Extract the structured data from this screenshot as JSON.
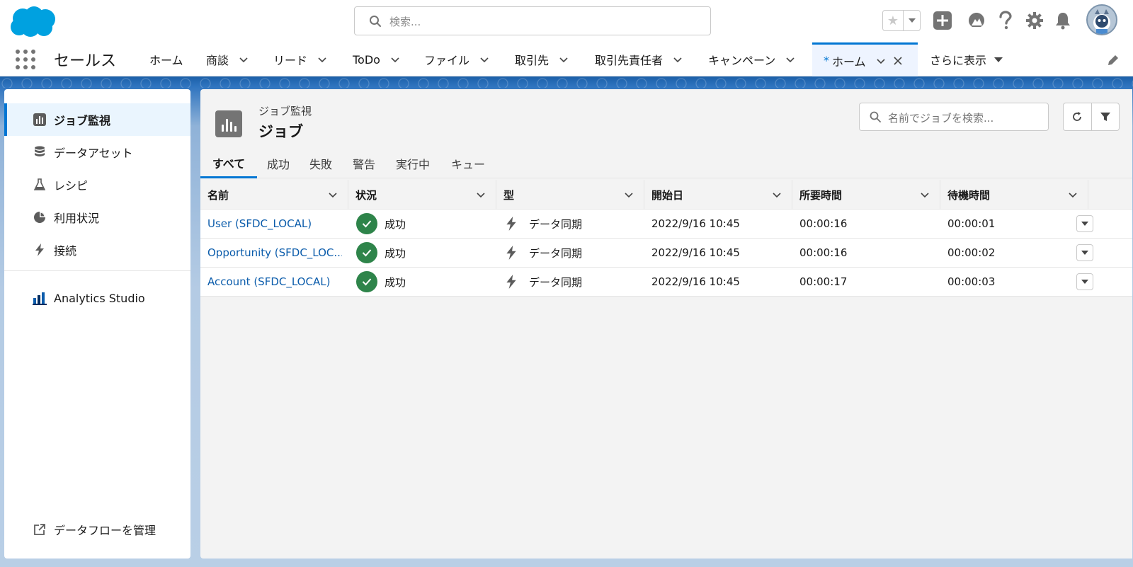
{
  "header": {
    "search_placeholder": "検索..."
  },
  "nav": {
    "app_name": "セールス",
    "tabs": [
      {
        "label": "ホーム"
      },
      {
        "label": "商談"
      },
      {
        "label": "リード"
      },
      {
        "label": "ToDo"
      },
      {
        "label": "ファイル"
      },
      {
        "label": "取引先"
      },
      {
        "label": "取引先責任者"
      },
      {
        "label": "キャンペーン"
      }
    ],
    "active_tab": {
      "marker": "*",
      "label": "ホーム"
    },
    "more_label": "さらに表示"
  },
  "sidebar": {
    "items": [
      {
        "label": "ジョブ監視",
        "icon": "chart-icon"
      },
      {
        "label": "データアセット",
        "icon": "database-icon"
      },
      {
        "label": "レシピ",
        "icon": "flask-icon"
      },
      {
        "label": "利用状況",
        "icon": "pie-chart-icon"
      },
      {
        "label": "接続",
        "icon": "bolt-icon"
      }
    ],
    "studio_label": "Analytics Studio",
    "footer_label": "データフローを管理"
  },
  "main": {
    "subtitle": "ジョブ監視",
    "title": "ジョブ",
    "search_placeholder": "名前でジョブを検索...",
    "filter_tabs": [
      "すべて",
      "成功",
      "失敗",
      "警告",
      "実行中",
      "キュー"
    ],
    "columns": [
      "名前",
      "状況",
      "型",
      "開始日",
      "所要時間",
      "待機時間"
    ],
    "rows": [
      {
        "name": "User (SFDC_LOCAL)",
        "status": "成功",
        "type": "データ同期",
        "start": "2022/9/16 10:45",
        "duration": "00:00:16",
        "wait": "00:00:01"
      },
      {
        "name": "Opportunity (SFDC_LOC...",
        "status": "成功",
        "type": "データ同期",
        "start": "2022/9/16 10:45",
        "duration": "00:00:16",
        "wait": "00:00:02"
      },
      {
        "name": "Account (SFDC_LOCAL)",
        "status": "成功",
        "type": "データ同期",
        "start": "2022/9/16 10:45",
        "duration": "00:00:17",
        "wait": "00:00:03"
      }
    ]
  },
  "colors": {
    "brand_blue": "#0176d3",
    "success_green": "#2e844a",
    "link_blue": "#0b5cab"
  }
}
